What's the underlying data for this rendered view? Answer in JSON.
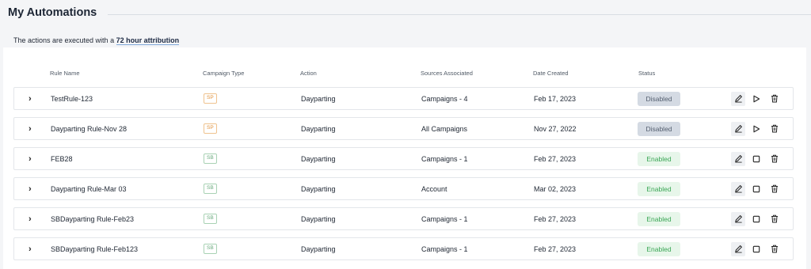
{
  "title": "My Automations",
  "attribution": {
    "prefix": "The actions are executed with a ",
    "value": "72 hour attribution"
  },
  "columns": {
    "rule_name": "Rule Name",
    "campaign_type": "Campaign Type",
    "action": "Action",
    "sources": "Sources Associated",
    "date_created": "Date Created",
    "status": "Status"
  },
  "rows": [
    {
      "name": "TestRule-123",
      "type": "SP",
      "action": "Dayparting",
      "sources": "Campaigns - 4",
      "date": "Feb 17, 2023",
      "status": "Disabled"
    },
    {
      "name": "Dayparting Rule-Nov 28",
      "type": "SP",
      "action": "Dayparting",
      "sources": "All Campaigns",
      "date": "Nov 27, 2022",
      "status": "Disabled"
    },
    {
      "name": "FEB28",
      "type": "SB",
      "action": "Dayparting",
      "sources": "Campaigns - 1",
      "date": "Feb 27, 2023",
      "status": "Enabled"
    },
    {
      "name": "Dayparting Rule-Mar 03",
      "type": "SB",
      "action": "Dayparting",
      "sources": "Account",
      "date": "Mar 02, 2023",
      "status": "Enabled"
    },
    {
      "name": "SBDayparting Rule-Feb23",
      "type": "SB",
      "action": "Dayparting",
      "sources": "Campaigns - 1",
      "date": "Feb 27, 2023",
      "status": "Enabled"
    },
    {
      "name": "SBDayparting Rule-Feb123",
      "type": "SB",
      "action": "Dayparting",
      "sources": "Campaigns - 1",
      "date": "Feb 27, 2023",
      "status": "Enabled"
    }
  ],
  "icons": {
    "expand": "chevron-right-icon",
    "edit": "pencil-icon",
    "play": "play-icon",
    "stop": "stop-icon",
    "delete": "trash-icon"
  },
  "colors": {
    "sp": "#e0913a",
    "sb": "#67a87b",
    "enabled": "#3aa655",
    "disabled_bg": "#d4dae3"
  }
}
